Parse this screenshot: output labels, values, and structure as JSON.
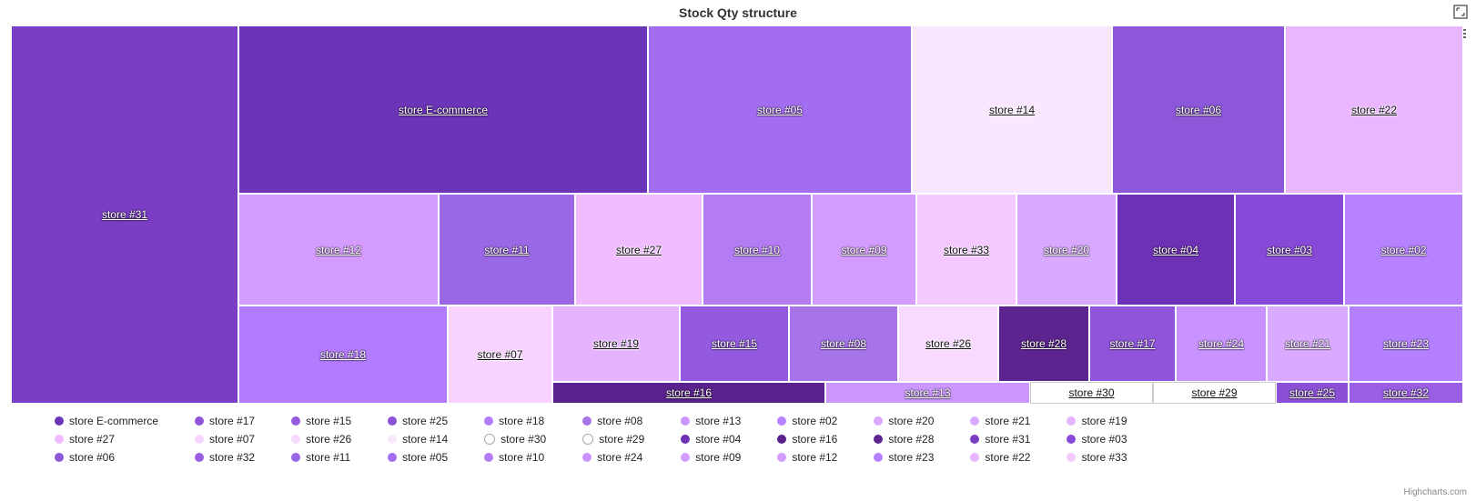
{
  "title": "Stock Qty structure",
  "credits": "Highcharts.com",
  "chart_data": {
    "type": "treemap",
    "title": "Stock Qty structure",
    "series": [
      {
        "name": "store #31",
        "value": 1000,
        "color": "#7a3ec4"
      },
      {
        "name": "store E-commerce",
        "value": 750,
        "color": "#6b34b9"
      },
      {
        "name": "store #05",
        "value": 480,
        "color": "#a26df0"
      },
      {
        "name": "store #14",
        "value": 360,
        "color": "#fae6ff"
      },
      {
        "name": "store #06",
        "value": 300,
        "color": "#8c57d8"
      },
      {
        "name": "store #22",
        "value": 300,
        "color": "#e9b6ff"
      },
      {
        "name": "store #12",
        "value": 290,
        "color": "#d59cff"
      },
      {
        "name": "store #11",
        "value": 200,
        "color": "#9a67e5"
      },
      {
        "name": "store #27",
        "value": 180,
        "color": "#f1bcff"
      },
      {
        "name": "store #10",
        "value": 150,
        "color": "#b37cf3"
      },
      {
        "name": "store #09",
        "value": 150,
        "color": "#d49cff"
      },
      {
        "name": "store #33",
        "value": 140,
        "color": "#f4c9ff"
      },
      {
        "name": "store #20",
        "value": 140,
        "color": "#d9a8ff"
      },
      {
        "name": "store #04",
        "value": 140,
        "color": "#6e30b4"
      },
      {
        "name": "store #03",
        "value": 140,
        "color": "#8749d7"
      },
      {
        "name": "store #02",
        "value": 120,
        "color": "#b682ff"
      },
      {
        "name": "store #18",
        "value": 190,
        "color": "#b27afc"
      },
      {
        "name": "store #07",
        "value": 150,
        "color": "#f8d3ff"
      },
      {
        "name": "store #19",
        "value": 140,
        "color": "#e6b3ff"
      },
      {
        "name": "store #15",
        "value": 120,
        "color": "#935ae0"
      },
      {
        "name": "store #08",
        "value": 120,
        "color": "#a673e8"
      },
      {
        "name": "store #26",
        "value": 110,
        "color": "#f8d9ff"
      },
      {
        "name": "store #28",
        "value": 100,
        "color": "#5d248f"
      },
      {
        "name": "store #17",
        "value": 100,
        "color": "#8f54da"
      },
      {
        "name": "store #24",
        "value": 100,
        "color": "#c893ff"
      },
      {
        "name": "store #21",
        "value": 90,
        "color": "#d9aaff"
      },
      {
        "name": "store #23",
        "value": 80,
        "color": "#b480ff"
      },
      {
        "name": "store #16",
        "value": 60,
        "color": "#5a228c"
      },
      {
        "name": "store #13",
        "value": 45,
        "color": "#cb97ff"
      },
      {
        "name": "store #30",
        "value": 50,
        "color": "#ffffff"
      },
      {
        "name": "store #29",
        "value": 50,
        "color": "#ffffff"
      },
      {
        "name": "store #25",
        "value": 15,
        "color": "#8b50d6"
      },
      {
        "name": "store #32",
        "value": 18,
        "color": "#9a5ee4"
      }
    ]
  },
  "cells": {
    "c31": "store #31",
    "cec": "store E-commerce",
    "c05": "store #05",
    "c14": "store #14",
    "c06": "store #06",
    "c22": "store #22",
    "c12": "store #12",
    "c11": "store #11",
    "c27": "store #27",
    "c10": "store #10",
    "c09": "store #09",
    "c33": "store #33",
    "c20": "store #20",
    "c04": "store #04",
    "c03": "store #03",
    "c02": "store #02",
    "c18": "store #18",
    "c07": "store #07",
    "c19": "store #19",
    "c15": "store #15",
    "c08": "store #08",
    "c26": "store #26",
    "c28": "store #28",
    "c17": "store #17",
    "c24": "store #24",
    "c21": "store #21",
    "c23": "store #23",
    "c16": "store #16",
    "c13": "store #13",
    "c30": "store #30",
    "c29": "store #29",
    "c25": "store #25",
    "c32": "store #32"
  },
  "legend": [
    {
      "label": "store E-commerce",
      "color": "#6b34b9"
    },
    {
      "label": "store #27",
      "color": "#f1bcff"
    },
    {
      "label": "store #06",
      "color": "#8c57d8"
    },
    {
      "label": "store #17",
      "color": "#8f54da"
    },
    {
      "label": "store #07",
      "color": "#f8d3ff"
    },
    {
      "label": "store #32",
      "color": "#9a5ee4"
    },
    {
      "label": "store #15",
      "color": "#935ae0"
    },
    {
      "label": "store #26",
      "color": "#f8d9ff"
    },
    {
      "label": "store #11",
      "color": "#9a67e5"
    },
    {
      "label": "store #25",
      "color": "#8b50d6"
    },
    {
      "label": "store #14",
      "color": "#fae6ff"
    },
    {
      "label": "store #05",
      "color": "#a26df0"
    },
    {
      "label": "store #18",
      "color": "#b27afc"
    },
    {
      "label": "store #30",
      "color": "#ffffff"
    },
    {
      "label": "store #10",
      "color": "#b37cf3"
    },
    {
      "label": "store #08",
      "color": "#a673e8"
    },
    {
      "label": "store #29",
      "color": "#ffffff"
    },
    {
      "label": "store #24",
      "color": "#c893ff"
    },
    {
      "label": "store #13",
      "color": "#cb97ff"
    },
    {
      "label": "store #04",
      "color": "#6e30b4"
    },
    {
      "label": "store #09",
      "color": "#d49cff"
    },
    {
      "label": "store #02",
      "color": "#b682ff"
    },
    {
      "label": "store #16",
      "color": "#5a228c"
    },
    {
      "label": "store #12",
      "color": "#d59cff"
    },
    {
      "label": "store #20",
      "color": "#d9a8ff"
    },
    {
      "label": "store #28",
      "color": "#5d248f"
    },
    {
      "label": "store #23",
      "color": "#b480ff"
    },
    {
      "label": "store #21",
      "color": "#d9aaff"
    },
    {
      "label": "store #31",
      "color": "#7a3ec4"
    },
    {
      "label": "store #22",
      "color": "#e9b6ff"
    },
    {
      "label": "store #19",
      "color": "#e6b3ff"
    },
    {
      "label": "store #03",
      "color": "#8749d7"
    },
    {
      "label": "store #33",
      "color": "#f4c9ff"
    }
  ]
}
